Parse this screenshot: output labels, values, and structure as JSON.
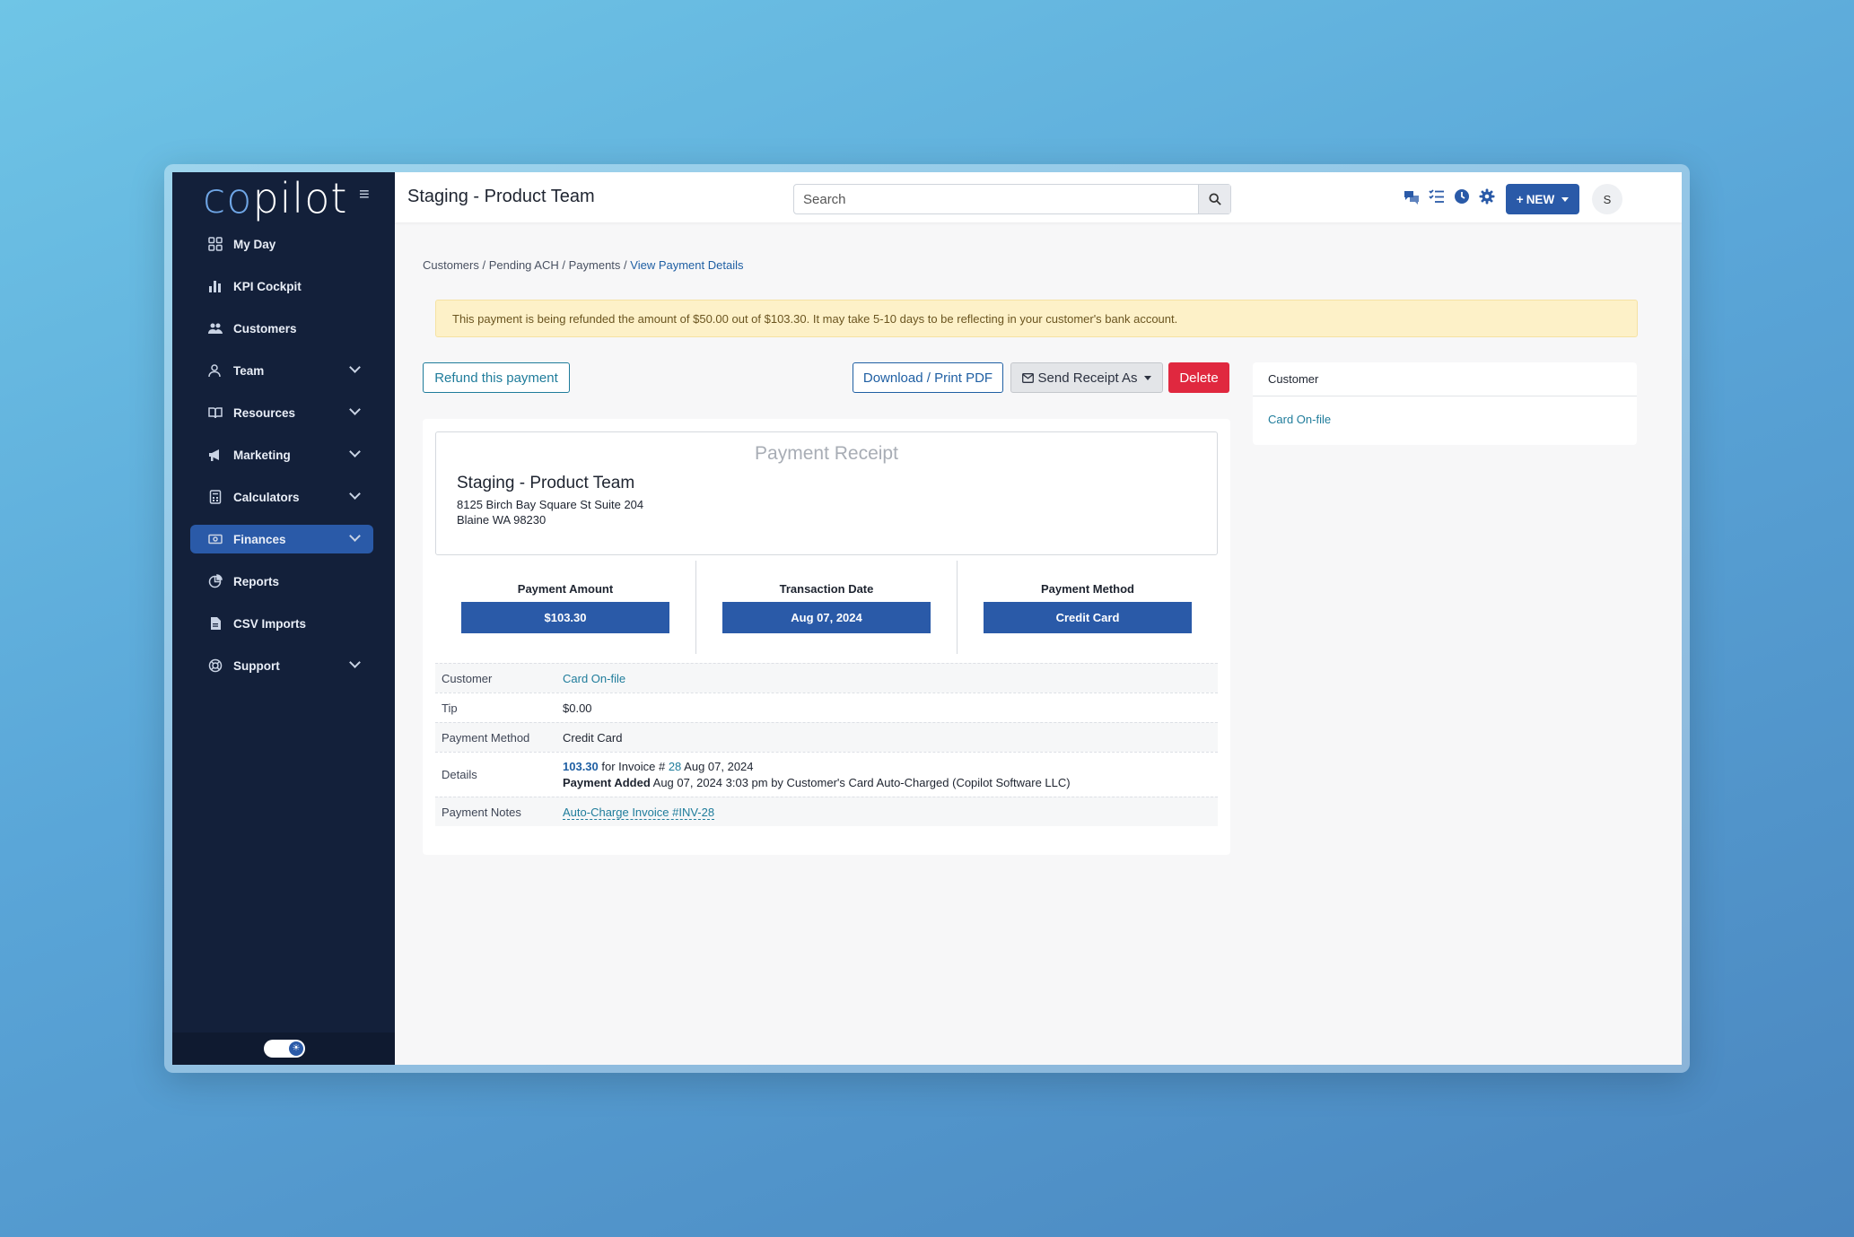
{
  "sidebar": {
    "logo_co": "co",
    "logo_rest": "pilot",
    "items": [
      {
        "label": "My Day",
        "icon": "grid-icon",
        "has_chevron": false
      },
      {
        "label": "KPI Cockpit",
        "icon": "bar-chart-icon",
        "has_chevron": false
      },
      {
        "label": "Customers",
        "icon": "users-icon",
        "has_chevron": false
      },
      {
        "label": "Team",
        "icon": "user-group-icon",
        "has_chevron": true
      },
      {
        "label": "Resources",
        "icon": "book-icon",
        "has_chevron": true
      },
      {
        "label": "Marketing",
        "icon": "megaphone-icon",
        "has_chevron": true
      },
      {
        "label": "Calculators",
        "icon": "calculator-icon",
        "has_chevron": true
      },
      {
        "label": "Finances",
        "icon": "money-icon",
        "has_chevron": true,
        "active": true
      },
      {
        "label": "Reports",
        "icon": "pie-chart-icon",
        "has_chevron": false
      },
      {
        "label": "CSV Imports",
        "icon": "csv-file-icon",
        "has_chevron": false
      },
      {
        "label": "Support",
        "icon": "lifebuoy-icon",
        "has_chevron": true
      }
    ]
  },
  "header": {
    "title": "Staging - Product Team",
    "search_placeholder": "Search",
    "new_label": "NEW",
    "avatar_initial": "S"
  },
  "breadcrumb": {
    "parts": [
      "Customers",
      "Pending ACH",
      "Payments"
    ],
    "current": "View Payment Details",
    "sep": " / "
  },
  "alert": {
    "text": "This payment is being refunded the amount of $50.00 out of $103.30. It may take 5-10 days to be reflecting in your customer's bank account."
  },
  "actions": {
    "refund": "Refund this payment",
    "pdf": "Download / Print PDF",
    "send": "Send Receipt As",
    "delete": "Delete"
  },
  "receipt": {
    "title": "Payment Receipt",
    "company": "Staging - Product Team",
    "address_line1": "8125 Birch Bay Square St Suite 204",
    "address_line2": "Blaine WA 98230"
  },
  "stats": [
    {
      "label": "Payment Amount",
      "value": "$103.30"
    },
    {
      "label": "Transaction Date",
      "value": "Aug 07, 2024"
    },
    {
      "label": "Payment Method",
      "value": "Credit Card"
    }
  ],
  "details": {
    "customer_label": "Customer",
    "customer_value": "Card On-file",
    "tip_label": "Tip",
    "tip_value": "$0.00",
    "method_label": "Payment Method",
    "method_value": "Credit Card",
    "details_label": "Details",
    "details_amount": "103.30",
    "details_for": " for Invoice # ",
    "details_invoice": "28",
    "details_date": " Aug 07, 2024",
    "details_added_label": "Payment Added",
    "details_added_text": " Aug 07, 2024 3:03 pm by Customer's Card Auto-Charged (Copilot Software LLC)",
    "notes_label": "Payment Notes",
    "notes_value": "Auto-Charge Invoice #INV-28"
  },
  "side_card": {
    "header": "Customer",
    "value": "Card On-file"
  },
  "colors": {
    "sidebar_bg": "#13203a",
    "accent": "#2a5aa8",
    "danger": "#e0283f",
    "link": "#1f7c9b",
    "alert_bg": "#fdf1c8"
  }
}
